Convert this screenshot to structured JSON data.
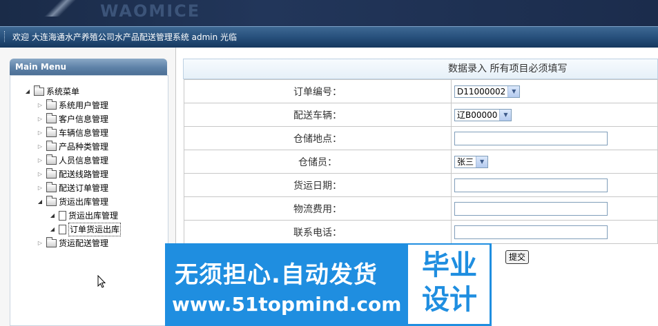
{
  "banner": {
    "logo_text": "WAOMICE"
  },
  "welcome_bar": {
    "text": "欢迎 大连海通水产养殖公司水产品配送管理系统 admin 光临"
  },
  "menu": {
    "title": "Main Menu",
    "root": "系统菜单",
    "items": [
      {
        "label": "系统用户管理"
      },
      {
        "label": "客户信息管理"
      },
      {
        "label": "车辆信息管理"
      },
      {
        "label": "产品种类管理"
      },
      {
        "label": "人员信息管理"
      },
      {
        "label": "配送线路管理"
      },
      {
        "label": "配送订单管理"
      },
      {
        "label": "货运出库管理",
        "children": [
          {
            "label": "货运出库管理"
          },
          {
            "label": "订单货运出库"
          }
        ]
      },
      {
        "label": "货运配送管理"
      }
    ]
  },
  "form": {
    "header": "数据录入 所有项目必须填写",
    "fields": [
      {
        "label": "订单编号：",
        "type": "select",
        "value": "D11000002"
      },
      {
        "label": "配送车辆：",
        "type": "select",
        "value": "辽B00000"
      },
      {
        "label": "仓储地点：",
        "type": "text",
        "value": ""
      },
      {
        "label": "仓储员：",
        "type": "select",
        "value": "张三"
      },
      {
        "label": "货运日期：",
        "type": "text",
        "value": ""
      },
      {
        "label": "物流费用：",
        "type": "text",
        "value": ""
      },
      {
        "label": "联系电话：",
        "type": "text",
        "value": ""
      }
    ],
    "submit_label": "提交"
  },
  "watermark": {
    "line1": "无须担心.自动发货",
    "line2": "www.51topmind.com",
    "box_line1": "毕业",
    "box_line2": "设计",
    "color": "#1f8ee0"
  },
  "icons": {
    "expanded": "triangle-down-icon",
    "collapsed": "triangle-right-icon",
    "folder": "folder-icon",
    "page": "page-icon",
    "cursor": "pointer-cursor-icon"
  }
}
